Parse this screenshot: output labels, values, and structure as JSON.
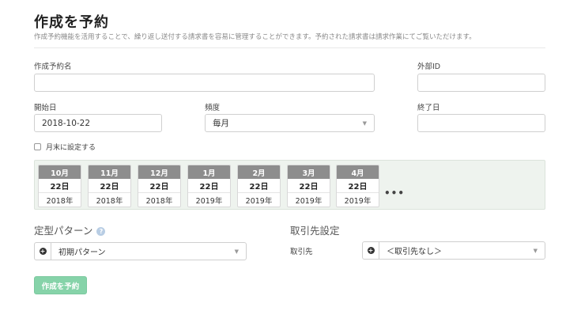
{
  "header": {
    "title": "作成を予約",
    "description": "作成予約機能を活用することで、繰り返し送付する請求書を容易に管理することができます。予約された請求書は請求作業にてご覧いただけます。"
  },
  "form": {
    "name_label": "作成予約名",
    "name_value": "",
    "external_id_label": "外部ID",
    "external_id_value": "",
    "start_date_label": "開始日",
    "start_date_value": "2018-10-22",
    "frequency_label": "頻度",
    "frequency_value": "毎月",
    "end_date_label": "終了日",
    "end_date_value": "",
    "month_end_label": "月末に設定する",
    "month_end_checked": false
  },
  "schedule": [
    {
      "month": "10月",
      "day": "22日",
      "year": "2018年"
    },
    {
      "month": "11月",
      "day": "22日",
      "year": "2018年"
    },
    {
      "month": "12月",
      "day": "22日",
      "year": "2018年"
    },
    {
      "month": "1月",
      "day": "22日",
      "year": "2019年"
    },
    {
      "month": "2月",
      "day": "22日",
      "year": "2019年"
    },
    {
      "month": "3月",
      "day": "22日",
      "year": "2019年"
    },
    {
      "month": "4月",
      "day": "22日",
      "year": "2019年"
    }
  ],
  "schedule_more": "•••",
  "pattern": {
    "section_title": "定型パターン",
    "help_icon": "?",
    "value": "初期パターン"
  },
  "client": {
    "section_title": "取引先設定",
    "label": "取引先",
    "value": "＜取引先なし＞"
  },
  "submit_label": "作成を予約",
  "colors": {
    "accent": "#86d3a9",
    "card_header": "#8d8d8d",
    "schedule_bg": "#eef3ee"
  }
}
